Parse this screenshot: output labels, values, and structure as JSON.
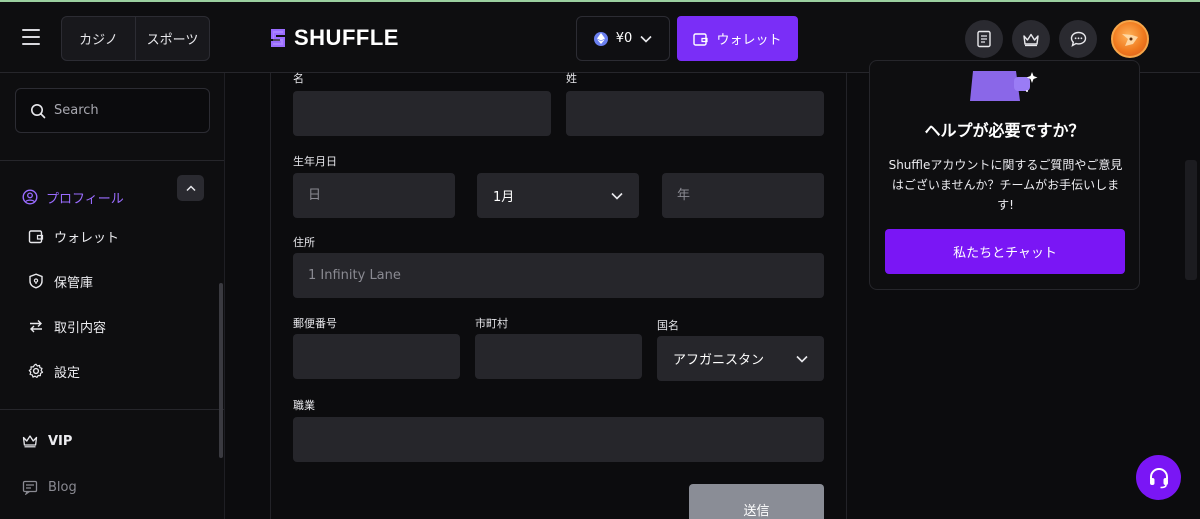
{
  "header": {
    "modes": [
      "カジノ",
      "スポーツ"
    ],
    "logo_text": "SHUFFLE",
    "balance": "¥0",
    "wallet_label": "ウォレット"
  },
  "sidebar": {
    "search_placeholder": "Search",
    "profile_label": "プロフィール",
    "items": [
      {
        "label": "ウォレット",
        "icon": "wallet-icon"
      },
      {
        "label": "保管庫",
        "icon": "vault-shield-icon"
      },
      {
        "label": "取引内容",
        "icon": "transfer-arrows-icon"
      },
      {
        "label": "設定",
        "icon": "gear-icon"
      }
    ],
    "vip_label": "VIP",
    "blog_label": "Blog"
  },
  "form": {
    "first_name_label": "名",
    "last_name_label": "姓",
    "dob_label": "生年月日",
    "day_placeholder": "日",
    "month_value": "1月",
    "year_placeholder": "年",
    "address_label": "住所",
    "address_placeholder": "1 Infinity Lane",
    "postal_label": "郵便番号",
    "city_label": "市町村",
    "country_label": "国名",
    "country_value": "アフガニスタン",
    "occupation_label": "職業",
    "submit_label": "送信"
  },
  "help": {
    "title": "ヘルプが必要ですか？",
    "text": "Shuffleアカウントに関するご質問やご意見はございませんか？チームがお手伝いします!",
    "chat_label": "私たちとチャット"
  },
  "colors": {
    "accent": "#7a2ef7",
    "profile_active": "#9a6cff",
    "field_bg": "#26262b"
  }
}
